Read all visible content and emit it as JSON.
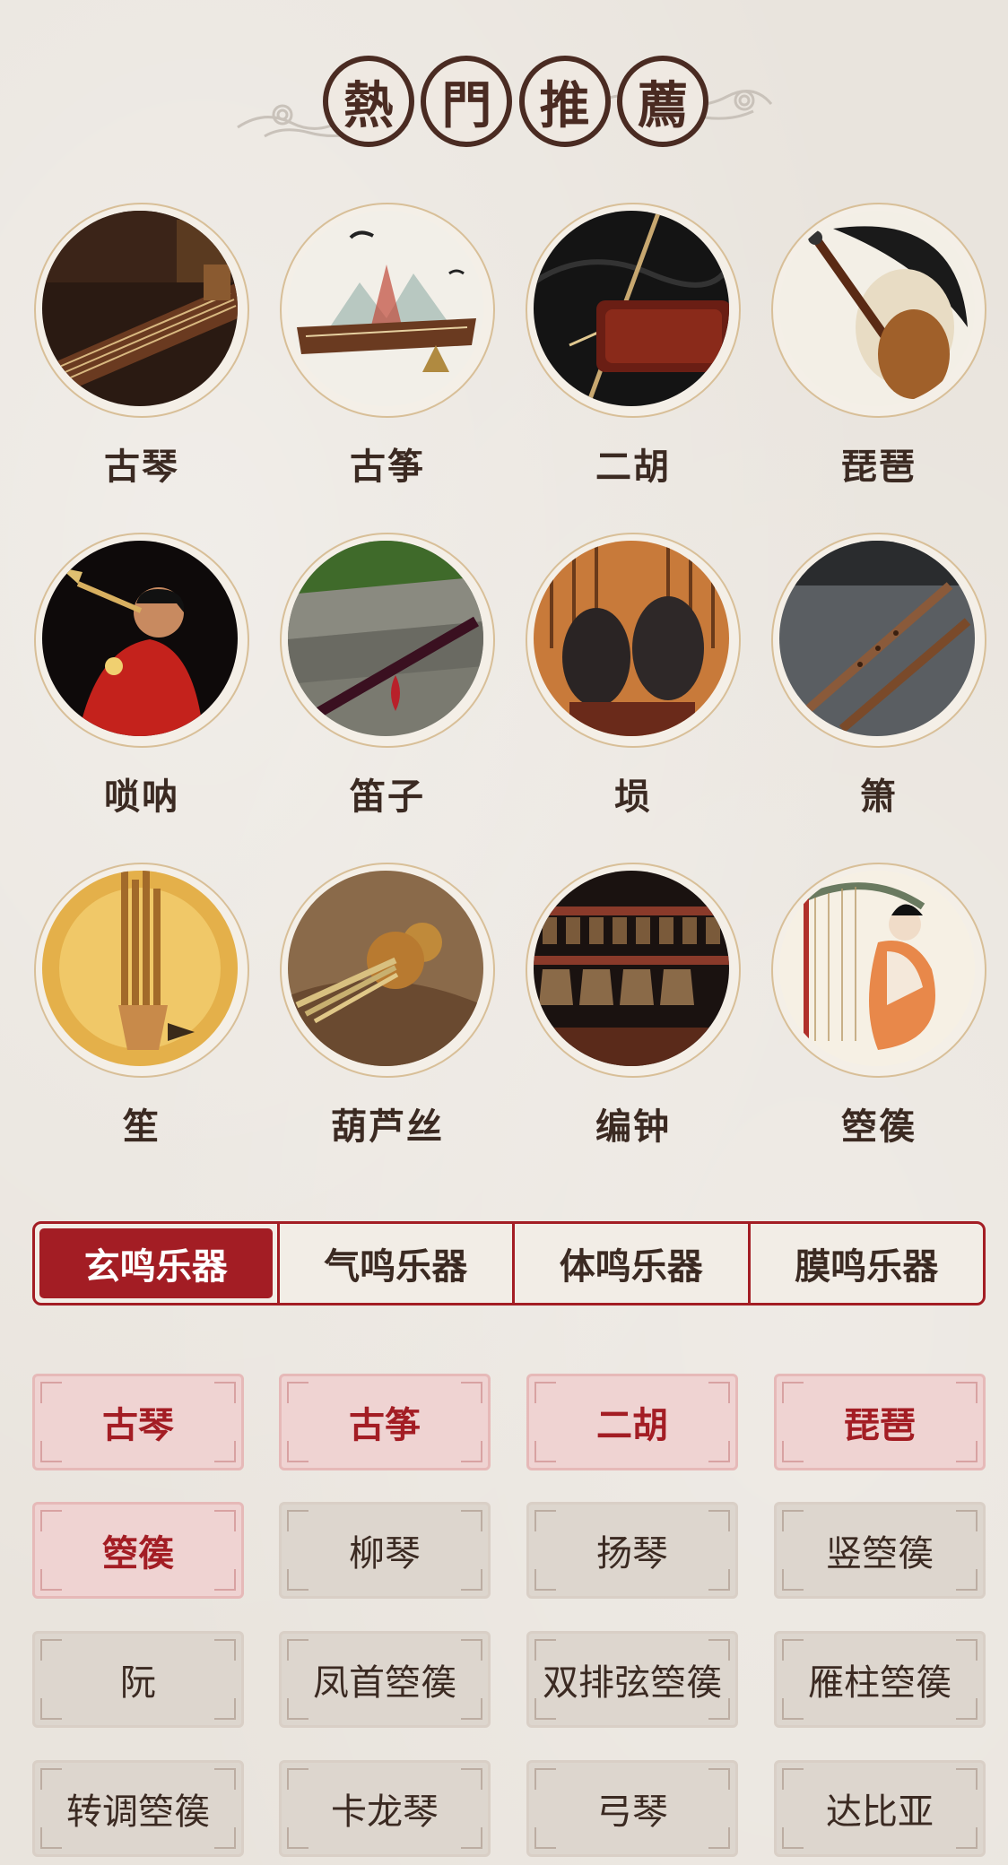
{
  "header": {
    "title_chars": [
      "熱",
      "門",
      "推",
      "薦"
    ]
  },
  "featured": [
    {
      "label": "古琴",
      "image": "guqin-photo"
    },
    {
      "label": "古筝",
      "image": "guzheng-ink-painting"
    },
    {
      "label": "二胡",
      "image": "erhu-photo"
    },
    {
      "label": "琵琶",
      "image": "pipa-ink-painting"
    },
    {
      "label": "唢呐",
      "image": "suona-player-photo"
    },
    {
      "label": "笛子",
      "image": "dizi-photo"
    },
    {
      "label": "埙",
      "image": "xun-photo"
    },
    {
      "label": "箫",
      "image": "xiao-photo"
    },
    {
      "label": "笙",
      "image": "sheng-photo"
    },
    {
      "label": "葫芦丝",
      "image": "hulusi-photo"
    },
    {
      "label": "编钟",
      "image": "bianzhong-photo"
    },
    {
      "label": "箜篌",
      "image": "konghou-illustration"
    }
  ],
  "tabs": [
    {
      "label": "玄鸣乐器",
      "active": true
    },
    {
      "label": "气鸣乐器",
      "active": false
    },
    {
      "label": "体鸣乐器",
      "active": false
    },
    {
      "label": "膜鸣乐器",
      "active": false
    }
  ],
  "instruments": [
    {
      "label": "古琴",
      "highlighted": true
    },
    {
      "label": "古筝",
      "highlighted": true
    },
    {
      "label": "二胡",
      "highlighted": true
    },
    {
      "label": "琵琶",
      "highlighted": true
    },
    {
      "label": "箜篌",
      "highlighted": true
    },
    {
      "label": "柳琴",
      "highlighted": false
    },
    {
      "label": "扬琴",
      "highlighted": false
    },
    {
      "label": "竖箜篌",
      "highlighted": false
    },
    {
      "label": "阮",
      "highlighted": false
    },
    {
      "label": "凤首箜篌",
      "highlighted": false
    },
    {
      "label": "双排弦箜篌",
      "highlighted": false
    },
    {
      "label": "雁柱箜篌",
      "highlighted": false
    },
    {
      "label": "转调箜篌",
      "highlighted": false
    },
    {
      "label": "卡龙琴",
      "highlighted": false
    },
    {
      "label": "弓琴",
      "highlighted": false
    },
    {
      "label": "达比亚",
      "highlighted": false
    }
  ],
  "colors": {
    "accent": "#a31d24",
    "highlight_chip": "#efd3d2",
    "chip": "#ddd6ce",
    "background": "#e9e4dd"
  }
}
